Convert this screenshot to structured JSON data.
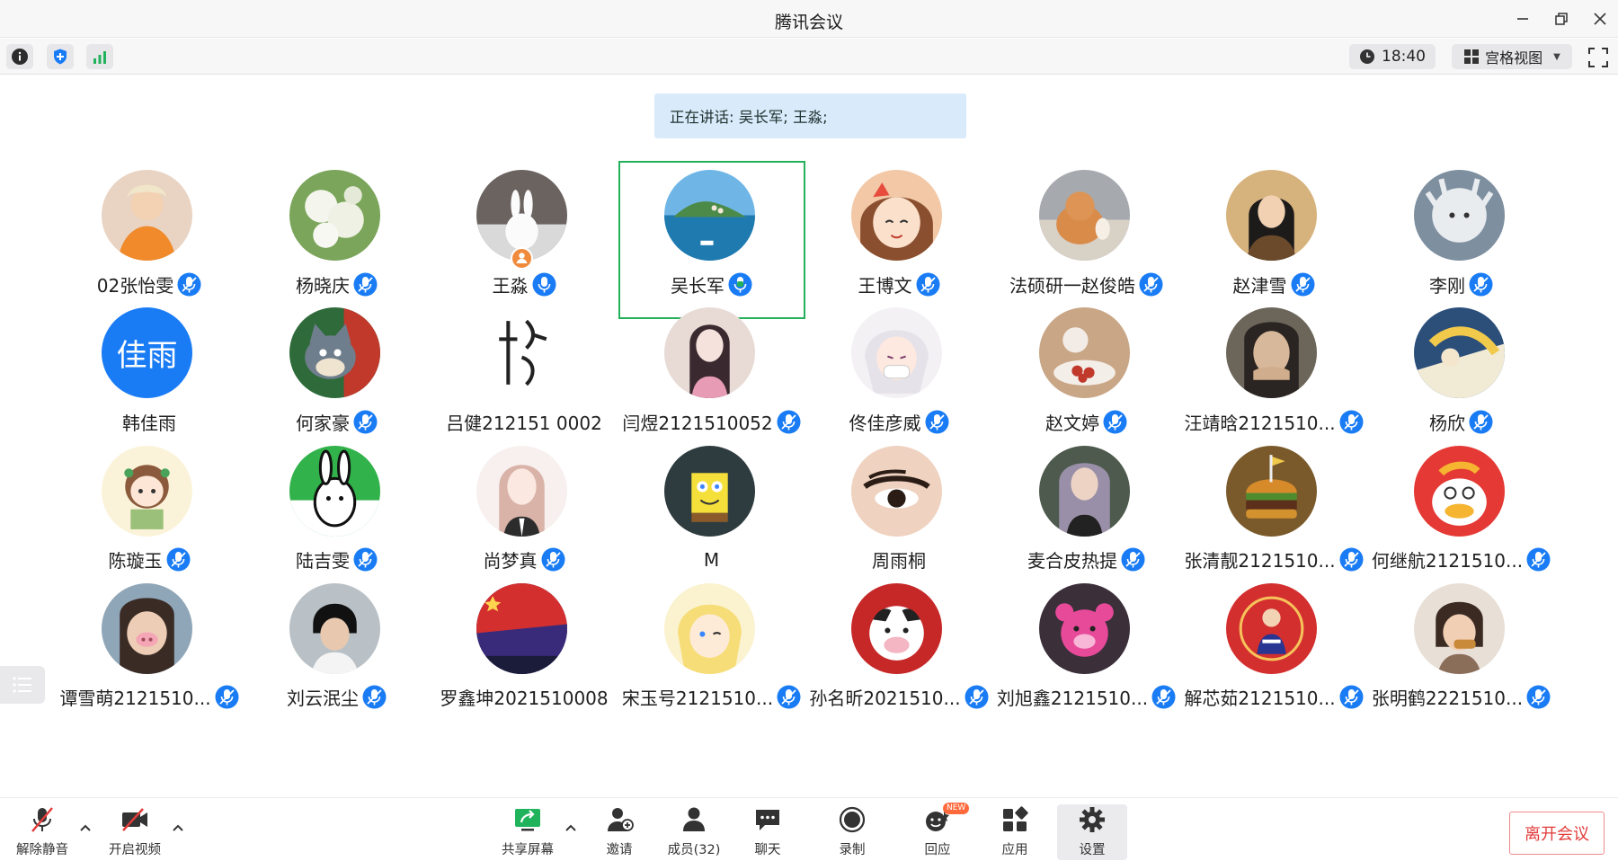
{
  "window": {
    "title": "腾讯会议"
  },
  "toolbar": {
    "clock": "18:40",
    "view_label": "宫格视图"
  },
  "speaking_banner": "正在讲话: 吴长军; 王淼;",
  "colors": {
    "accent_blue": "#1a7cf5",
    "speaking_green": "#23b05b",
    "leave_red": "#e23b3b",
    "banner_bg": "#d9eafa"
  },
  "participants": [
    {
      "name": "02张怡雯",
      "mic": "muted",
      "avatar": "photo-girl-orange"
    },
    {
      "name": "杨晓庆",
      "mic": "muted",
      "avatar": "white-flowers"
    },
    {
      "name": "王淼",
      "mic": "speaking",
      "avatar": "white-rabbit",
      "host": true
    },
    {
      "name": "吴长军",
      "mic": "speaking-green",
      "avatar": "island-lake",
      "active": true
    },
    {
      "name": "王博文",
      "mic": "muted",
      "avatar": "anime-girl"
    },
    {
      "name": "法硕研一赵俊皓",
      "mic": "muted",
      "avatar": "orange-cat"
    },
    {
      "name": "赵津雪",
      "mic": "muted",
      "avatar": "photo-woman"
    },
    {
      "name": "李刚",
      "mic": "muted",
      "avatar": "sketch-character"
    },
    {
      "name": "韩佳雨",
      "mic": "none",
      "avatar": "text",
      "avatar_text": "佳雨"
    },
    {
      "name": "何家豪",
      "mic": "muted",
      "avatar": "cartoon-cat"
    },
    {
      "name": "吕健212151 0002",
      "mic": "none",
      "avatar": "calligraphy"
    },
    {
      "name": "闫煜2121510052",
      "mic": "muted",
      "avatar": "pink-hair-girl"
    },
    {
      "name": "佟佳彦威",
      "mic": "muted",
      "avatar": "white-hair-anime"
    },
    {
      "name": "赵文婷",
      "mic": "muted",
      "avatar": "cat-and-cake"
    },
    {
      "name": "汪靖晗2121510...",
      "mic": "muted",
      "avatar": "selfie"
    },
    {
      "name": "杨欣",
      "mic": "muted",
      "avatar": "manga-panel"
    },
    {
      "name": "陈璇玉",
      "mic": "muted",
      "avatar": "cartoon-girl-book"
    },
    {
      "name": "陆吉雯",
      "mic": "muted",
      "avatar": "cartoon-rabbit"
    },
    {
      "name": "尚梦真",
      "mic": "muted",
      "avatar": "illustrated-girl"
    },
    {
      "name": "M",
      "mic": "none",
      "avatar": "sponge-character"
    },
    {
      "name": "周雨桐",
      "mic": "none",
      "avatar": "eye-closeup"
    },
    {
      "name": "麦合皮热提",
      "mic": "muted",
      "avatar": "long-hair-woman"
    },
    {
      "name": "张清靓2121510...",
      "mic": "muted",
      "avatar": "burger"
    },
    {
      "name": "何继航2121510...",
      "mic": "muted",
      "avatar": "cartoon-duck"
    },
    {
      "name": "谭雪萌2121510...",
      "mic": "muted",
      "avatar": "pig-nose-photo"
    },
    {
      "name": "刘云泯尘",
      "mic": "muted",
      "avatar": "hockey-player"
    },
    {
      "name": "罗鑫坤2021510008",
      "mic": "none",
      "avatar": "flag-sky"
    },
    {
      "name": "宋玉号2121510...",
      "mic": "muted",
      "avatar": "blonde-anime"
    },
    {
      "name": "孙名昕2021510...",
      "mic": "muted",
      "avatar": "cow-costume"
    },
    {
      "name": "刘旭鑫2121510...",
      "mic": "muted",
      "avatar": "pink-bear"
    },
    {
      "name": "解芯茹2121510...",
      "mic": "muted",
      "avatar": "red-circle-figure"
    },
    {
      "name": "张明鹤2221510...",
      "mic": "muted",
      "avatar": "baby-eating"
    }
  ],
  "bottombar": {
    "unmute": "解除静音",
    "video": "开启视频",
    "share": "共享屏幕",
    "invite": "邀请",
    "members": "成员(32)",
    "chat": "聊天",
    "record": "录制",
    "reactions": "回应",
    "reactions_badge": "NEW",
    "apps": "应用",
    "settings": "设置",
    "leave": "离开会议"
  }
}
